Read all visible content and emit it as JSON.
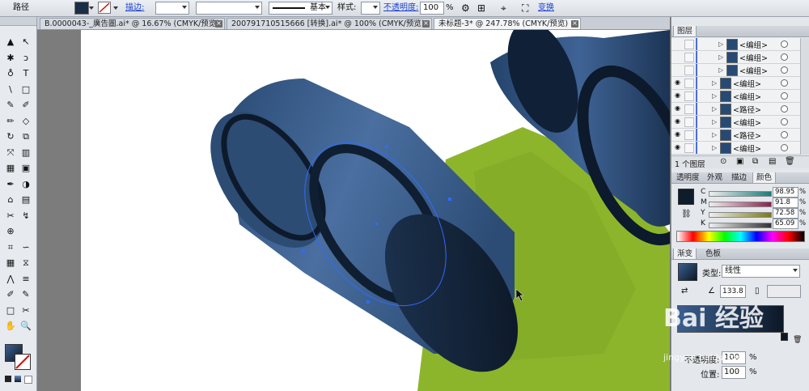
{
  "control_bar": {
    "object_type": "路径",
    "stroke_label": "描边:",
    "stroke_profile": "基本",
    "style_label": "样式:",
    "opacity_label": "不透明度:",
    "opacity_value": "100",
    "opacity_unit": "%",
    "transform_label": "变换"
  },
  "tabs": [
    {
      "label": "B.0000043-_廣告圖.ai* @ 16.67% (CMYK/预览)",
      "active": false
    },
    {
      "label": "200791710515666  [转换].ai* @ 100% (CMYK/预览)",
      "active": false
    },
    {
      "label": "未标题-3* @ 247.78% (CMYK/预览)",
      "active": true
    }
  ],
  "tab_close": "×",
  "tools": [
    "▲",
    "↖",
    "✱",
    "ↄ",
    "♁",
    "T",
    "\\",
    "□",
    "✎",
    "✐",
    "✏",
    "◇",
    "↻",
    "⧉",
    "⤧",
    "▥",
    "▦",
    "▣",
    "✒",
    "◑",
    "⌂",
    "▤",
    "✂",
    "↯",
    "⊕",
    "",
    "⌗",
    "∽",
    "▦",
    "⧖",
    "⋀",
    "≡",
    "✐",
    "✎",
    "□",
    "✂",
    "✋",
    "🔍"
  ],
  "layers_panel": {
    "title": "图层",
    "rows": [
      {
        "name": "<编组>",
        "indent": 3,
        "eye": false
      },
      {
        "name": "<编组>",
        "indent": 3,
        "eye": false
      },
      {
        "name": "<编组>",
        "indent": 3,
        "eye": false
      },
      {
        "name": "<编组>",
        "indent": 2,
        "eye": true
      },
      {
        "name": "<编组>",
        "indent": 2,
        "eye": true
      },
      {
        "name": "<路径>",
        "indent": 2,
        "eye": true
      },
      {
        "name": "<编组>",
        "indent": 2,
        "eye": true
      },
      {
        "name": "<路径>",
        "indent": 2,
        "eye": true
      },
      {
        "name": "<编组>",
        "indent": 2,
        "eye": true
      }
    ],
    "layer_count": "1 个图层"
  },
  "color_panel": {
    "tabs": [
      "透明度",
      "外观",
      "描边",
      "颜色"
    ],
    "active_tab": "颜色",
    "channels": [
      {
        "label": "C",
        "value": "98.95",
        "unit": "%",
        "color": "#1d7a7a"
      },
      {
        "label": "M",
        "value": "91.8",
        "unit": "%",
        "color": "#8a1f4d"
      },
      {
        "label": "Y",
        "value": "72.58",
        "unit": "%",
        "color": "#7a7a16"
      },
      {
        "label": "K",
        "value": "65.09",
        "unit": "%",
        "color": "#333333"
      }
    ],
    "fill_color": "#0f1c2b"
  },
  "gradient_panel": {
    "tabs": [
      "渐变",
      "色板"
    ],
    "active_tab": "渐变",
    "type_label": "类型:",
    "type_value": "线性",
    "angle_value": "133.8",
    "opacity_label": "不透明度:",
    "opacity_value": "100",
    "location_label": "位置:",
    "location_value": "100",
    "unit": "%",
    "gradient_from": "#3b5f8f",
    "gradient_to": "#0c1726"
  },
  "watermark": {
    "text": "Bai 经验",
    "url": "jingyan.baidu.com"
  },
  "colors": {
    "cylinder_light": "#4d73a6",
    "cylinder_dark": "#13263f",
    "green": "#8db52c",
    "selection": "#2f6bff"
  }
}
